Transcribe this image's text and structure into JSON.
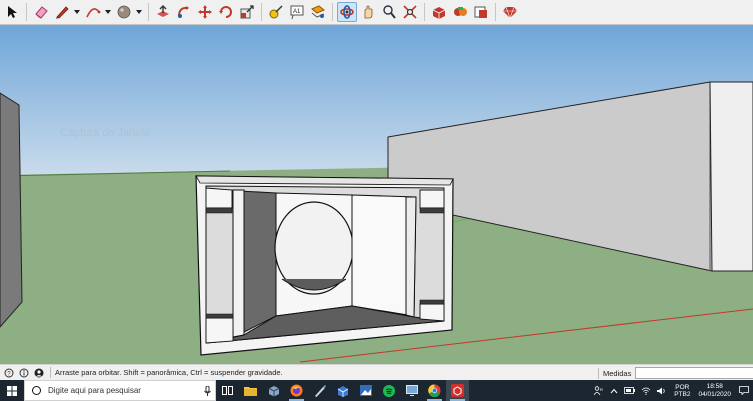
{
  "toolbar": {
    "tools": [
      {
        "icon": "select-arrow-icon"
      },
      {
        "icon": "eraser-icon"
      },
      {
        "icon": "pencil-line-icon"
      },
      {
        "icon": "arc-icon"
      },
      {
        "icon": "paint-bucket-icon"
      },
      {
        "icon": "push-pull-icon"
      },
      {
        "icon": "follow-me-icon"
      },
      {
        "icon": "move-icon"
      },
      {
        "icon": "rotate-icon"
      },
      {
        "icon": "scale-icon"
      },
      {
        "icon": "tape-measure-icon"
      },
      {
        "icon": "text-icon"
      },
      {
        "icon": "section-plane-icon"
      },
      {
        "icon": "orbit-icon"
      },
      {
        "icon": "pan-icon"
      },
      {
        "icon": "zoom-icon"
      },
      {
        "icon": "zoom-extents-icon"
      },
      {
        "icon": "3d-warehouse-icon"
      },
      {
        "icon": "extension-warehouse-icon"
      },
      {
        "icon": "layout-icon"
      },
      {
        "icon": "ruby-console-icon"
      }
    ],
    "active_tool": "orbit-icon"
  },
  "viewport": {
    "ghost_label": "Captura de Janela",
    "colors": {
      "sky": "#a9c6e4",
      "ground": "#8daf83",
      "building": "#c8c8c8"
    }
  },
  "statusbar": {
    "hint": "Arraste para orbitar. Shift = panorâmica, Ctrl = suspender gravidade.",
    "measure_label": "Medidas",
    "measure_value": ""
  },
  "taskbar": {
    "search_placeholder": "Digite aqui para pesquisar",
    "apps": [
      {
        "icon": "task-view-icon"
      },
      {
        "icon": "file-explorer-icon"
      },
      {
        "icon": "box-app-icon"
      },
      {
        "icon": "firefox-icon"
      },
      {
        "icon": "paint-brush-icon"
      },
      {
        "icon": "sketchup-blue-icon"
      },
      {
        "icon": "photos-icon"
      },
      {
        "icon": "spotify-icon"
      },
      {
        "icon": "display-icon"
      },
      {
        "icon": "chrome-icon"
      },
      {
        "icon": "sketchup-red-icon"
      }
    ],
    "lang": "POR",
    "lang_sub": "PTB2",
    "time": "18:58",
    "date": "04/01/2020"
  }
}
